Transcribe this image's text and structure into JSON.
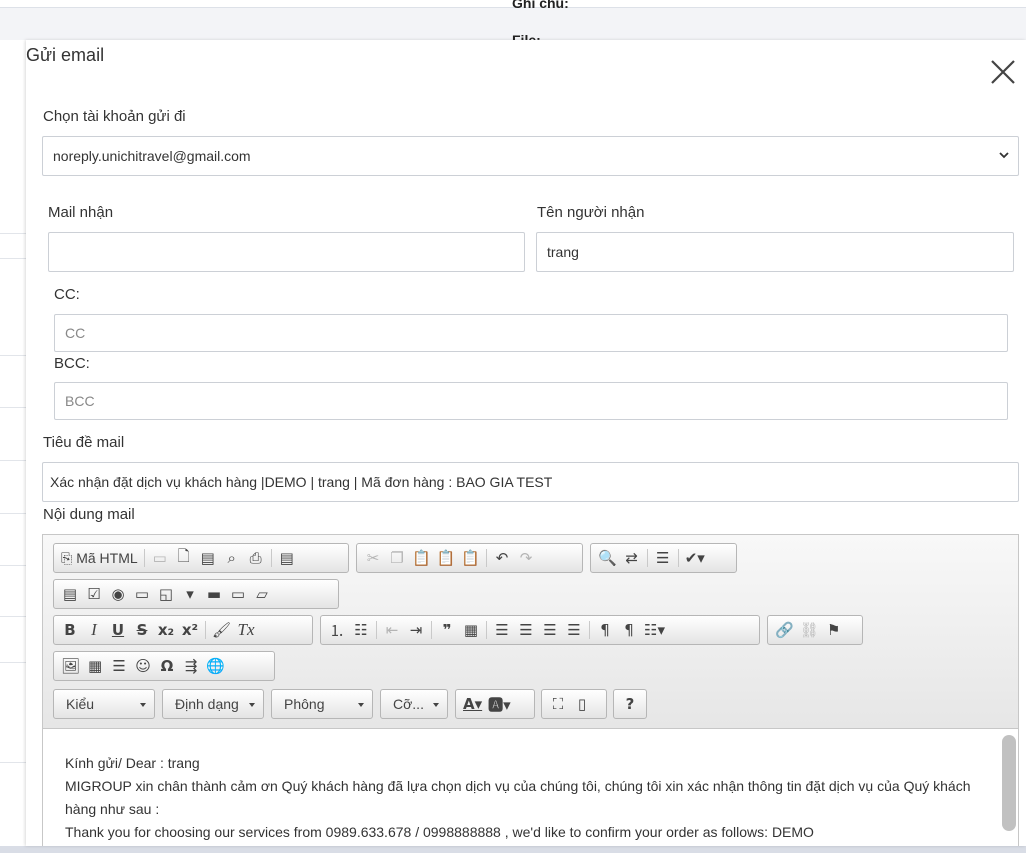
{
  "background": {
    "peek_note": "Ghi chú:",
    "peek_file": "File:"
  },
  "modal": {
    "title": "Gửi email",
    "close_icon": "close-icon"
  },
  "sender": {
    "label": "Chọn tài khoản gửi đi",
    "value": "noreply.unichitravel@gmail.com"
  },
  "recipient": {
    "mail_label": "Mail nhận",
    "mail_value": "",
    "name_label": "Tên người nhận",
    "name_value": "trang"
  },
  "cc": {
    "label": "CC:",
    "placeholder": "CC"
  },
  "bcc": {
    "label": "BCC:",
    "placeholder": "BCC"
  },
  "subject": {
    "label": "Tiêu đề mail",
    "value": "Xác nhận đặt dịch vụ khách hàng |DEMO | trang | Mã đơn hàng : BAO GIA TEST"
  },
  "body": {
    "label": "Nội dung mail",
    "toolbar": {
      "source_label": "Mã HTML",
      "style_combo": "Kiểu",
      "format_combo": "Định dạng",
      "font_combo": "Phông",
      "size_combo": "Cỡ...",
      "help_label": "?"
    },
    "content_lines": [
      "Kính gửi/ Dear : trang",
      "MIGROUP xin chân thành cảm ơn Quý khách hàng đã lựa chọn dịch vụ của chúng tôi, chúng tôi xin xác nhận thông tin đặt dịch vụ của Quý khách hàng như sau :",
      "Thank you for choosing our services from 0989.633.678 / 0998888888 , we'd like to confirm your order as follows: DEMO"
    ]
  }
}
